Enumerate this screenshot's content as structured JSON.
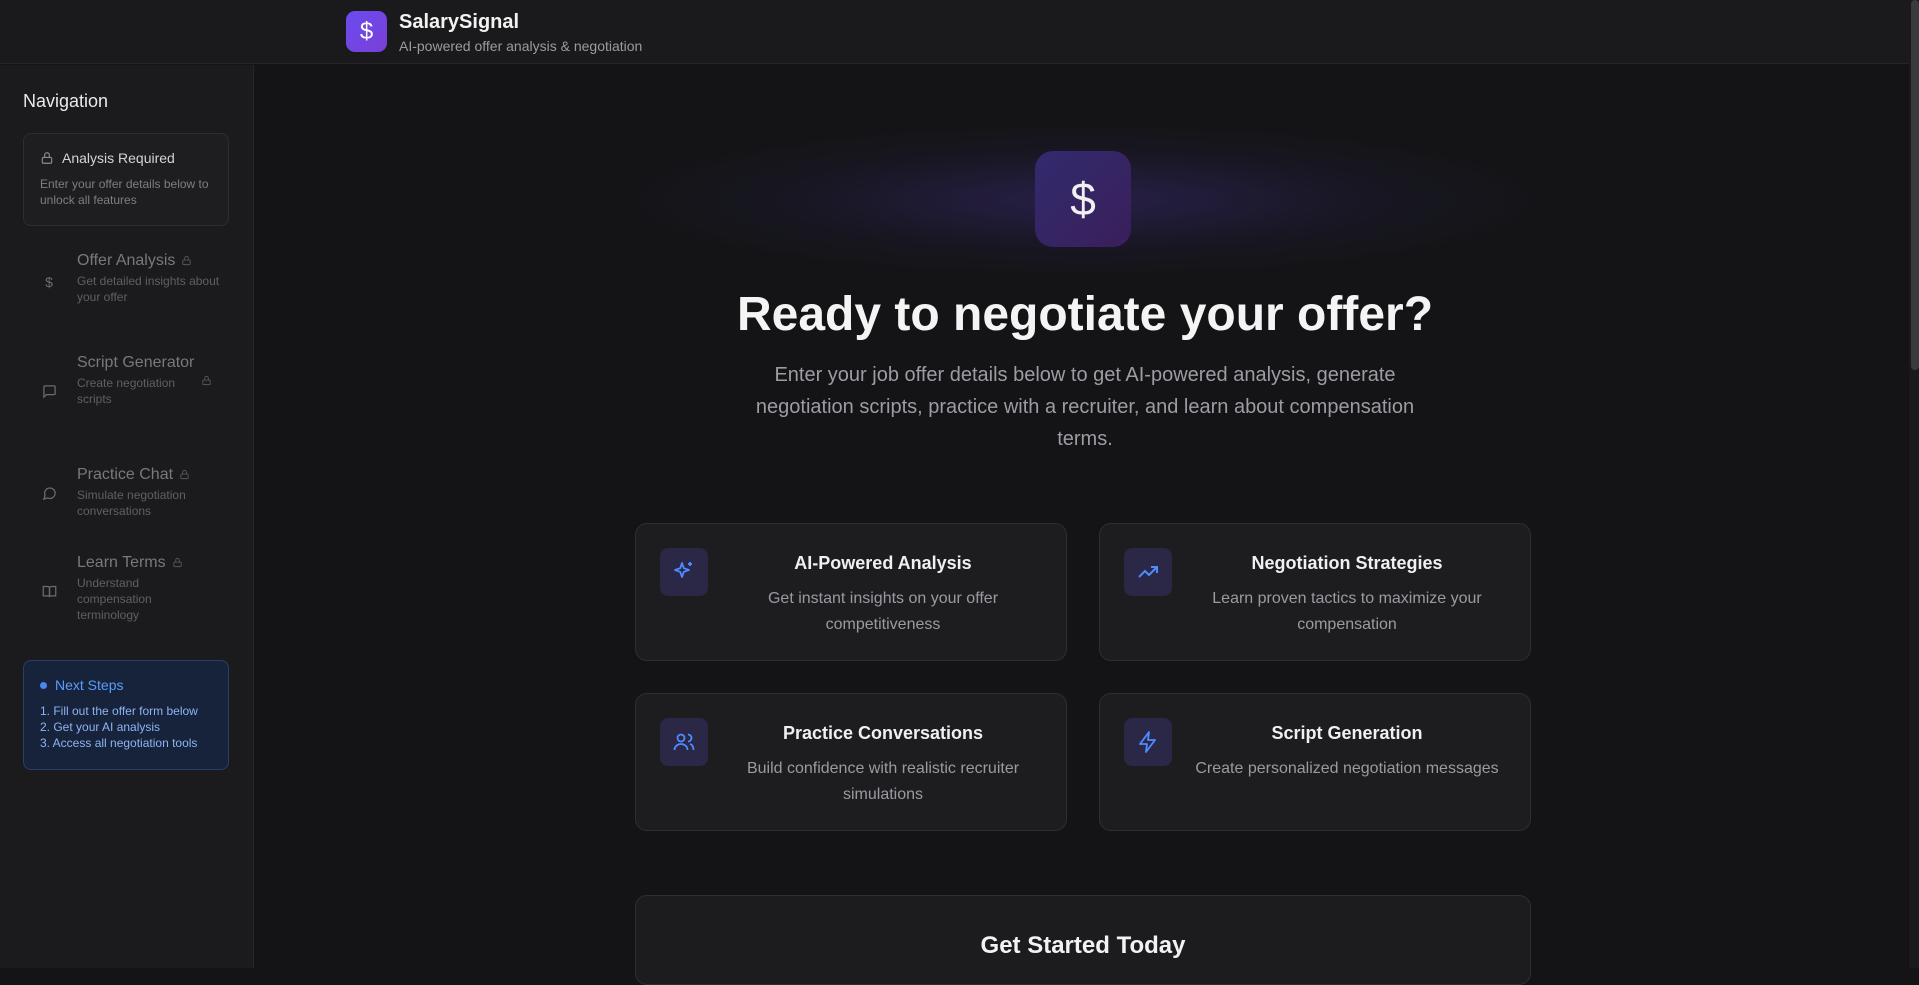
{
  "app": {
    "title": "SalarySignal",
    "subtitle": "AI-powered offer analysis & negotiation",
    "logo_icon": "dollar-icon"
  },
  "sidebar": {
    "title": "Navigation",
    "alert": {
      "title": "Analysis Required",
      "text": "Enter your offer details below to unlock all features"
    },
    "items": [
      {
        "label": "Offer Analysis",
        "desc": "Get detailed insights about your offer",
        "icon": "dollar-icon",
        "locked": true
      },
      {
        "label": "Script Generator",
        "desc": "Create negotiation scripts",
        "icon": "message-square-icon",
        "locked": true
      },
      {
        "label": "Practice Chat",
        "desc": "Simulate negotiation conversations",
        "icon": "chat-bubble-icon",
        "locked": true
      },
      {
        "label": "Learn Terms",
        "desc": "Understand compensation terminology",
        "icon": "book-icon",
        "locked": true
      }
    ],
    "next_steps": {
      "title": "Next Steps",
      "steps": [
        "1. Fill out the offer form below",
        "2. Get your AI analysis",
        "3. Access all negotiation tools"
      ]
    }
  },
  "hero": {
    "title": "Ready to negotiate your offer?",
    "subtitle": "Enter your job offer details below to get AI-powered analysis, generate negotiation scripts, practice with a recruiter, and learn about compensation terms."
  },
  "features": [
    {
      "title": "AI-Powered Analysis",
      "desc": "Get instant insights on your offer competitiveness",
      "icon": "sparkles-icon"
    },
    {
      "title": "Negotiation Strategies",
      "desc": "Learn proven tactics to maximize your compensation",
      "icon": "trending-up-icon"
    },
    {
      "title": "Practice Conversations",
      "desc": "Build confidence with realistic recruiter simulations",
      "icon": "users-icon"
    },
    {
      "title": "Script Generation",
      "desc": "Create personalized negotiation messages",
      "icon": "lightning-icon"
    }
  ],
  "cta": {
    "title": "Get Started Today"
  },
  "colors": {
    "accent": "#6a4cf0",
    "icon_blue": "#4f8cff",
    "next_steps_bg": "#17233a"
  }
}
